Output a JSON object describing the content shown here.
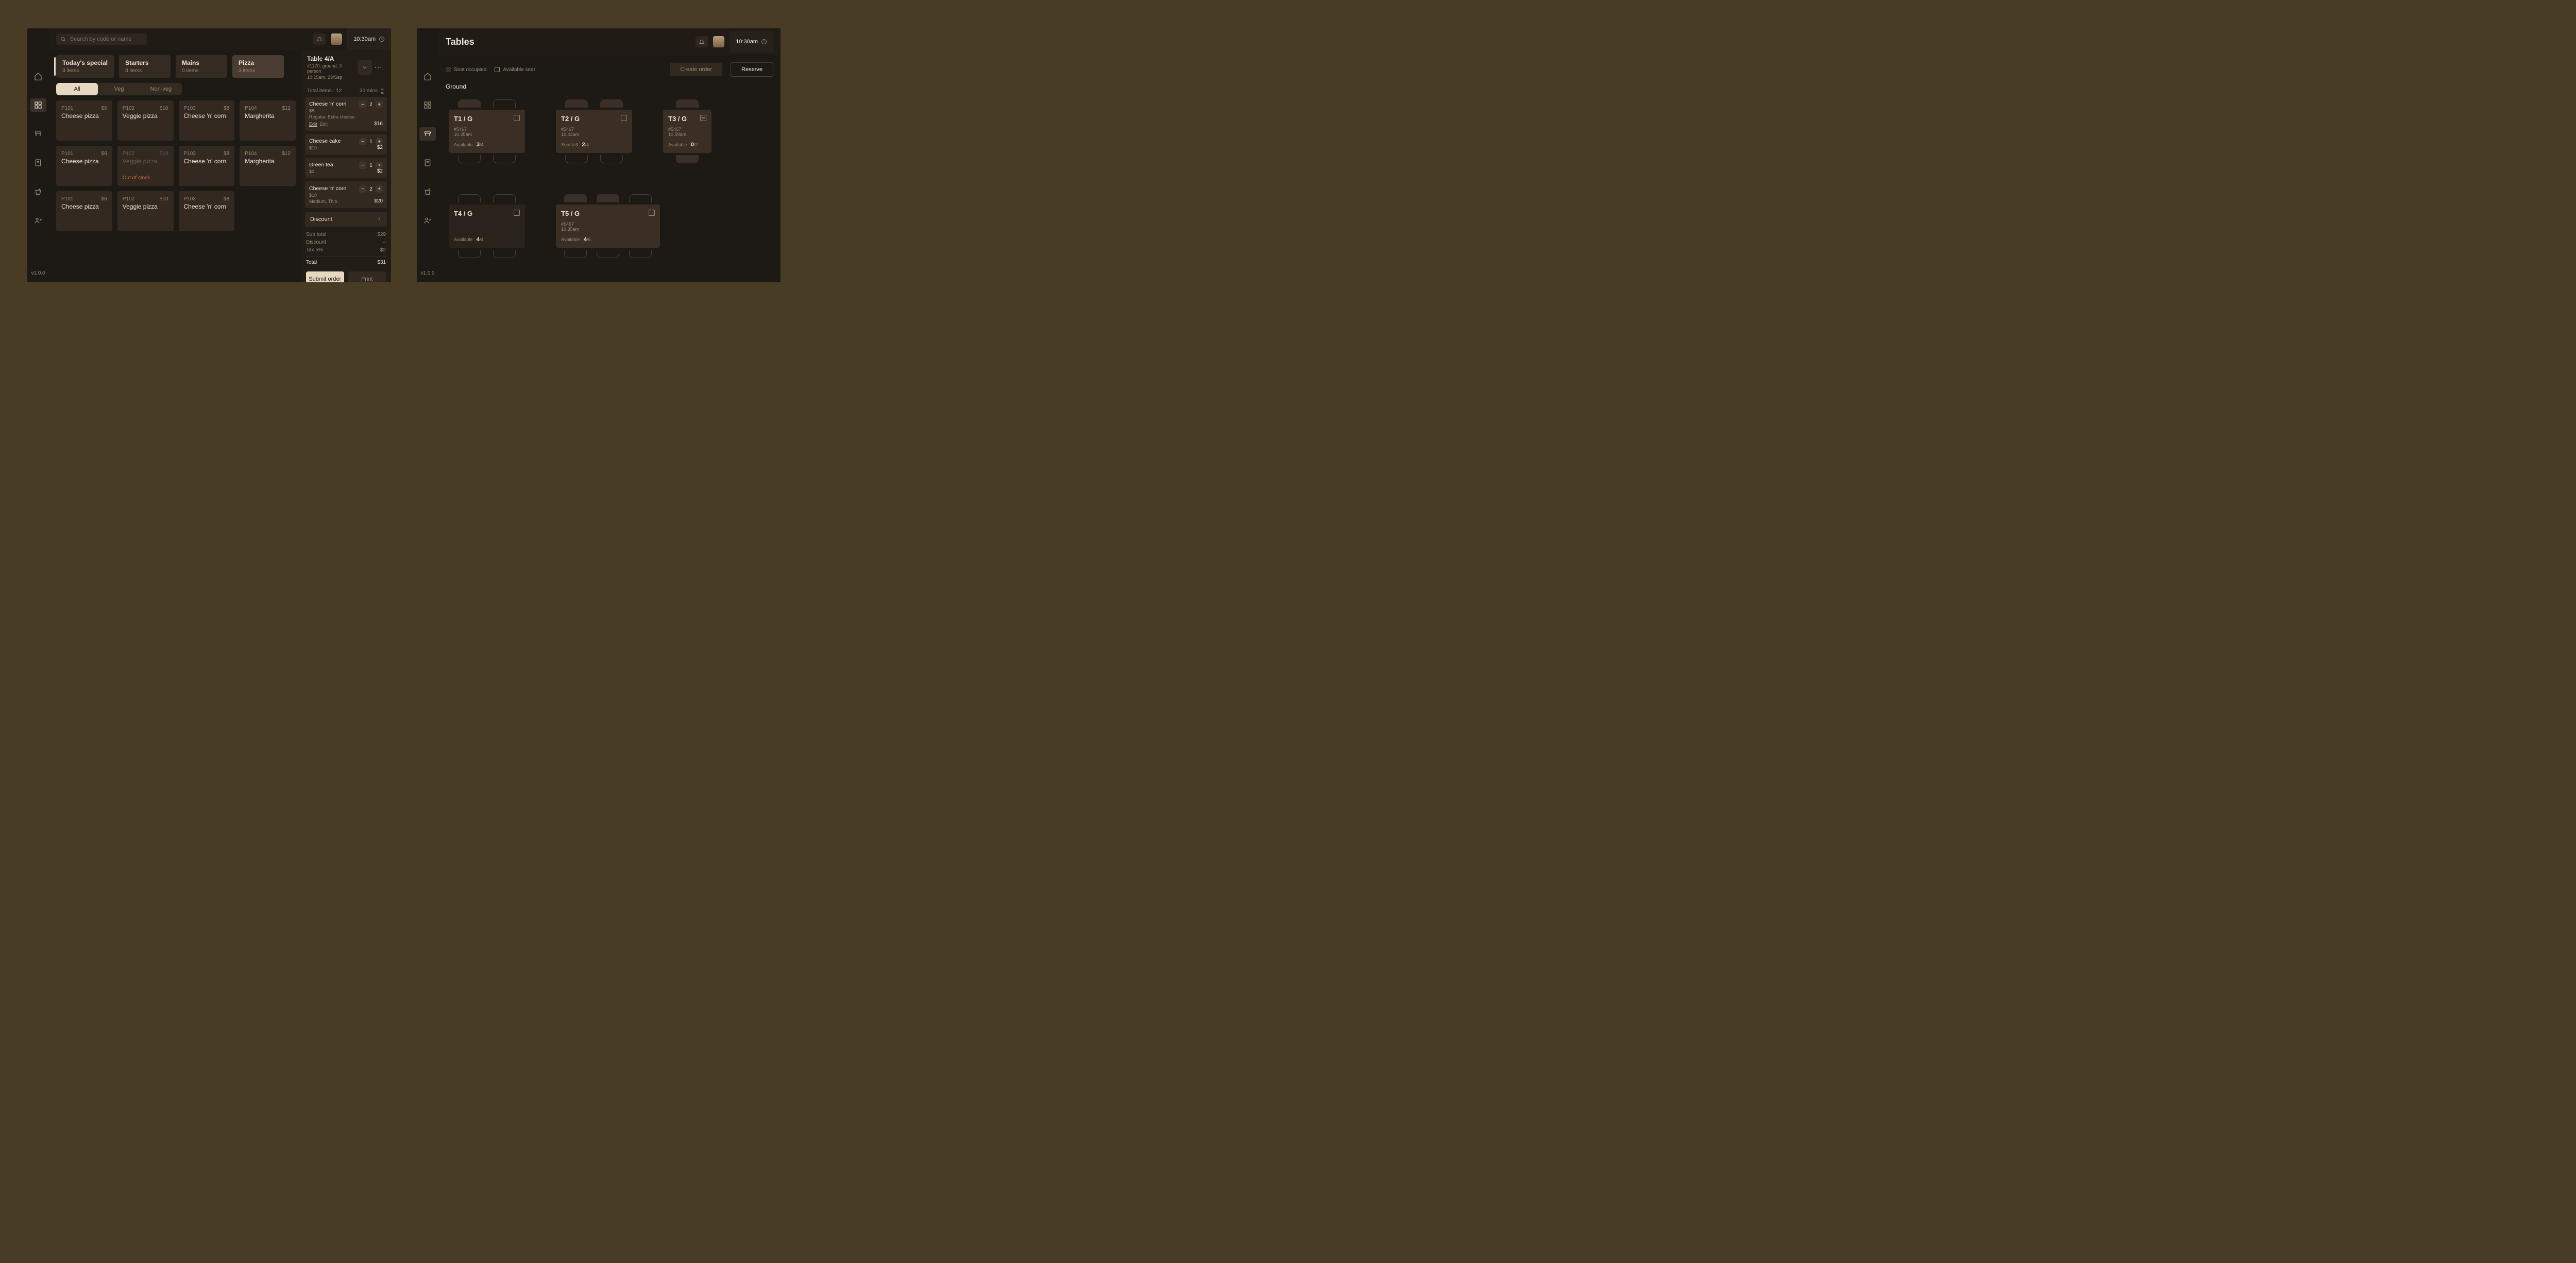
{
  "common": {
    "clock": "10:30am",
    "version": "v1.0.0",
    "search_placeholder": "Search by code or name"
  },
  "left_app": {
    "categories": [
      {
        "label": "Today's special",
        "sub": "3 items"
      },
      {
        "label": "Starters",
        "sub": "3 items"
      },
      {
        "label": "Mains",
        "sub": "0 items"
      },
      {
        "label": "Pizza",
        "sub": "3 items",
        "active": true
      }
    ],
    "filters": {
      "all": "All",
      "veg": "Veg",
      "nonveg": "Non-veg"
    },
    "products": [
      {
        "code": "P101",
        "price": "$6",
        "name": "Cheese pizza"
      },
      {
        "code": "P102",
        "price": "$10",
        "name": "Veggie pizza"
      },
      {
        "code": "P103",
        "price": "$8",
        "name": "Cheese 'n' corn"
      },
      {
        "code": "P104",
        "price": "$12",
        "name": "Margherita"
      },
      {
        "code": "P101",
        "price": "$6",
        "name": "Cheese pizza"
      },
      {
        "code": "P102",
        "price": "$10",
        "name": "Veggie pizza",
        "oos": "Out of stock"
      },
      {
        "code": "P103",
        "price": "$8",
        "name": "Cheese 'n' corn"
      },
      {
        "code": "P104",
        "price": "$12",
        "name": "Margherita"
      },
      {
        "code": "P101",
        "price": "$6",
        "name": "Cheese pizza"
      },
      {
        "code": "P102",
        "price": "$10",
        "name": "Veggie pizza"
      },
      {
        "code": "P103",
        "price": "$8",
        "name": "Cheese 'n' corn"
      }
    ],
    "order": {
      "table": "Table 4/A",
      "meta1": "#1170, ground, 3 person",
      "meta2": "10:15am, 23/Sep",
      "total_items_label": "Total items : 12",
      "timer": "30 mins",
      "items": [
        {
          "name": "Cheese 'n' corn",
          "price": "$8",
          "qty": "2",
          "line": "$16",
          "note": "Regular, Extra cheese",
          "edit": true
        },
        {
          "name": "Cheese cake",
          "price": "$10",
          "qty": "1",
          "line": "$2"
        },
        {
          "name": "Green tea",
          "price": "$2",
          "qty": "1",
          "line": "$2"
        },
        {
          "name": "Cheese 'n' corn",
          "price": "$10",
          "qty": "2",
          "line": "$20",
          "note": "Medium, Thin"
        }
      ],
      "discount_label": "Discount",
      "totals": {
        "sub_label": "Sub total",
        "sub": "$29",
        "disc_label": "Discount",
        "disc": "--",
        "tax_label": "Tax 5%",
        "tax": "$2",
        "total_label": "Total",
        "total": "$31"
      },
      "submit": "Submit order",
      "print": "Print",
      "edit_link": "Edit",
      "edit_text": "Edit"
    }
  },
  "right_app": {
    "title": "Tables",
    "legend": {
      "occ": "Seat occupied",
      "av": "Available seat"
    },
    "buttons": {
      "create": "Create order",
      "reserve": "Reserve"
    },
    "floor": "Ground",
    "tables": [
      {
        "name": "T1 / G",
        "oid": "#5467",
        "time": "10.35am",
        "status_label": "Available :",
        "left": "3",
        "cap": "/4",
        "occupied": true,
        "seats": 4,
        "occ_seats": 1,
        "mark": "square"
      },
      {
        "name": "T2 / G",
        "oid": "#5467",
        "time": "10.42am",
        "status_label": "Seat left :",
        "left": "2",
        "cap": "/4",
        "occupied": true,
        "seats": 4,
        "occ_seats": 2,
        "mark": "square"
      },
      {
        "name": "T3 / G",
        "oid": "#5467",
        "time": "10.59am",
        "status_label": "Available :",
        "left": "0",
        "cap": "/2",
        "occupied": true,
        "seats": 2,
        "occ_seats": 2,
        "mark": "minus"
      },
      {
        "name": "T4 / G",
        "status_label": "Available :",
        "left": "4",
        "cap": "/4",
        "occupied": false,
        "seats": 4,
        "occ_seats": 0,
        "mark": "square"
      },
      {
        "name": "T5 / G",
        "oid": "#5467",
        "time": "10.35am",
        "status_label": "Available :",
        "left": "4",
        "cap": "/6",
        "occupied": true,
        "seats": 6,
        "occ_seats": 2,
        "mark": "square"
      }
    ]
  }
}
